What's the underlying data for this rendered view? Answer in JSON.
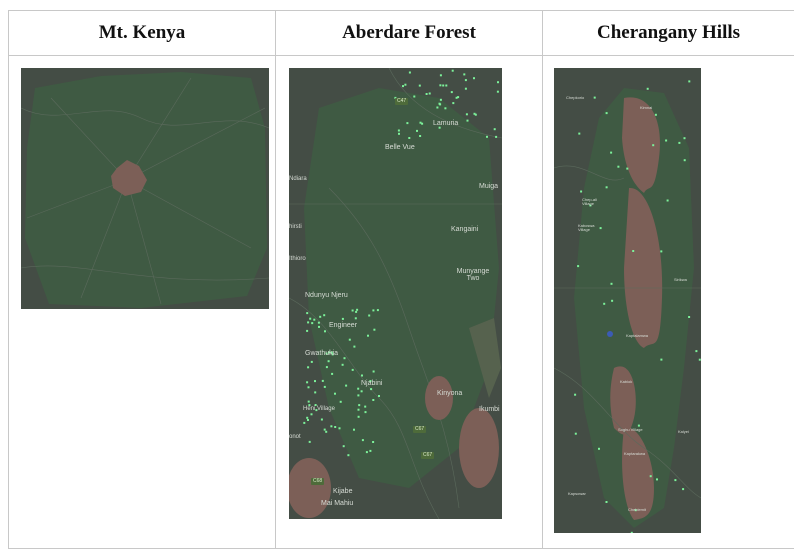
{
  "table": {
    "headers": [
      "Mt. Kenya",
      "Aberdare Forest",
      "Cherangany Hills"
    ]
  },
  "maps": {
    "mt_kenya": {
      "icon": "map-tile"
    },
    "aberdare": {
      "icon": "map-tile",
      "places": [
        "Lamuria",
        "Belle Vue",
        "Muiga",
        "Ndiara",
        "Kangaini",
        "hirsti",
        "Ithioro",
        "Munyange Two",
        "Ndunyu Njeru",
        "Engineer",
        "Gwathukia",
        "Njabini",
        "Kinyona",
        "Ikumbi",
        "Heni Village",
        "onot",
        "Kijabe",
        "Mai Mahiu"
      ],
      "road_badges": [
        "C47",
        "C67",
        "C67",
        "C68"
      ]
    },
    "cherangany": {
      "icon": "map-tile",
      "places": [
        "Chepkorio",
        "Kimnai",
        "Chep-ali Village",
        "Kaboswa Village",
        "Sirikwa",
        "Kaptalamwa",
        "Kabiok",
        "Soghu Village",
        "Kalyei",
        "Kaptarakwa",
        "Kapsowar",
        "Chebiemit"
      ]
    },
    "overlay_color": "#7cf29a",
    "forest_color": "#3f5a43",
    "barren_color": "#7c5f57"
  }
}
